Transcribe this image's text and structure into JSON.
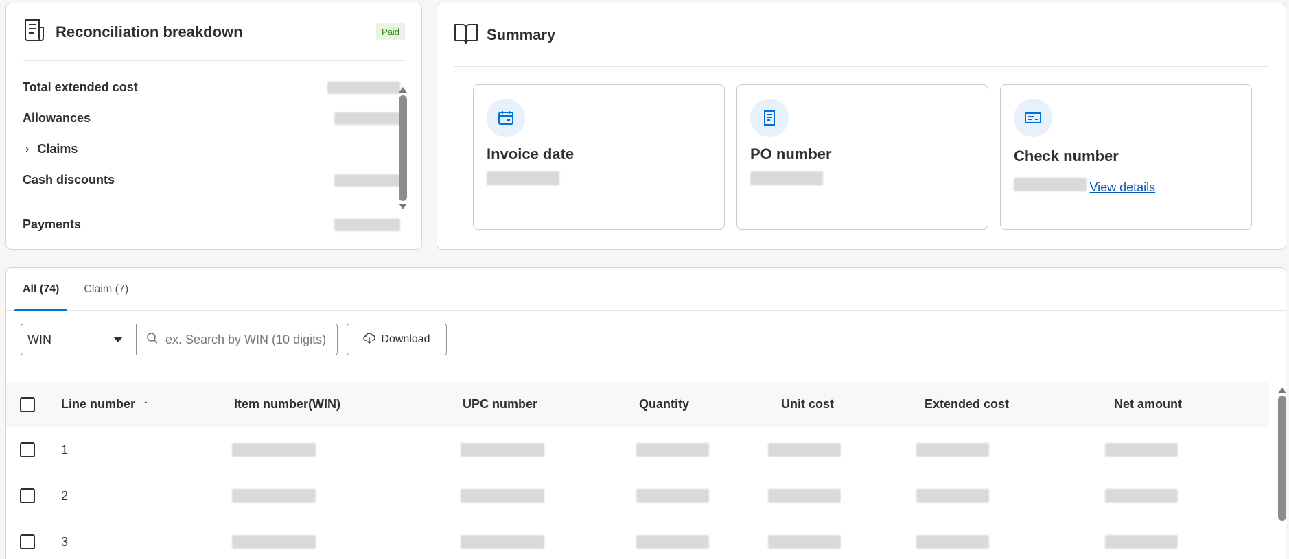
{
  "reconciliation": {
    "title": "Reconciliation breakdown",
    "status_badge": "Paid",
    "rows": [
      {
        "label": "Total extended cost",
        "expandable": false
      },
      {
        "label": "Allowances",
        "expandable": false
      },
      {
        "label": "Claims",
        "expandable": true
      },
      {
        "label": "Cash discounts",
        "expandable": false
      },
      {
        "label": "Payments",
        "expandable": false
      }
    ]
  },
  "summary": {
    "title": "Summary",
    "tiles": [
      {
        "title": "Invoice date",
        "icon": "calendar-icon"
      },
      {
        "title": "PO number",
        "icon": "document-icon"
      },
      {
        "title": "Check number",
        "icon": "check-icon",
        "link": "View details"
      }
    ]
  },
  "tabs": [
    {
      "label": "All (74)",
      "active": true
    },
    {
      "label": "Claim (7)",
      "active": false
    }
  ],
  "filter": {
    "selected": "WIN",
    "search_placeholder": "ex. Search by WIN (10 digits)",
    "download_label": "Download"
  },
  "table": {
    "columns": [
      "Line number",
      "Item number(WIN)",
      "UPC number",
      "Quantity",
      "Unit cost",
      "Extended cost",
      "Net amount"
    ],
    "sort_indicator": "↑",
    "rows": [
      {
        "line": "1"
      },
      {
        "line": "2"
      },
      {
        "line": "3"
      }
    ]
  },
  "colors": {
    "accent": "#0071dc",
    "link": "#0b59b5",
    "paid_badge_bg": "#eaf3e6",
    "paid_badge_text": "#2a8703",
    "icon_bg": "#e6f1fc"
  }
}
